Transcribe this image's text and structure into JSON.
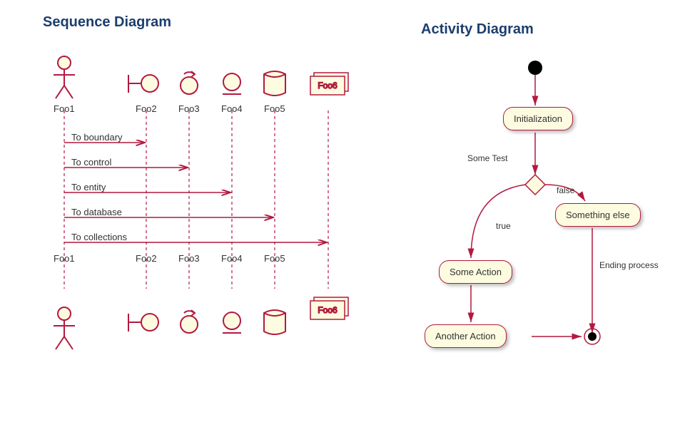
{
  "titles": {
    "left": "Sequence Diagram",
    "right": "Activity Diagram"
  },
  "sequence": {
    "participants": [
      "Foo1",
      "Foo2",
      "Foo3",
      "Foo4",
      "Foo5",
      "Foo6"
    ],
    "messages": [
      {
        "label": "To boundary",
        "to": 1
      },
      {
        "label": "To control",
        "to": 2
      },
      {
        "label": "To entity",
        "to": 3
      },
      {
        "label": "To database",
        "to": 4
      },
      {
        "label": "To collections",
        "to": 5
      }
    ]
  },
  "activity": {
    "nodes": {
      "init": "Initialization",
      "decision_label": "Some Test",
      "branch_true": "true",
      "branch_false": "false",
      "action1": "Some Action",
      "action2": "Something else",
      "action3": "Another Action",
      "end_label": "Ending process"
    }
  }
}
